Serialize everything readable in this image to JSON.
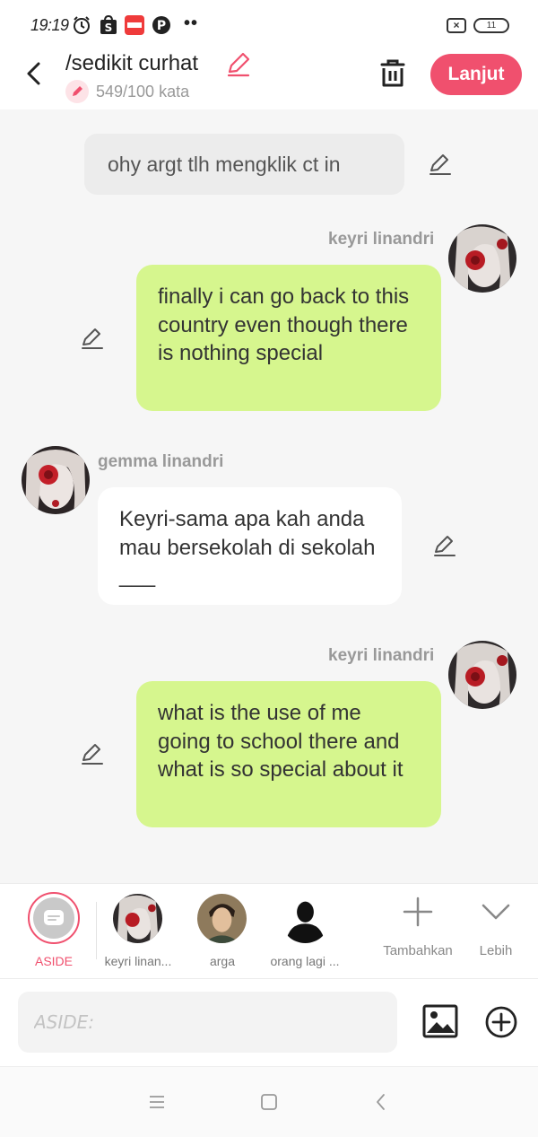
{
  "status_bar": {
    "time": "19:19",
    "icons": [
      "alarm-icon",
      "shopee-icon",
      "mangatoon-icon",
      "pinterest-icon",
      "more-dots-icon",
      "sim-x-icon",
      "battery-icon"
    ],
    "dots": "••",
    "battery_level": "11"
  },
  "header": {
    "title": "/sedikit curhat",
    "word_count": "549/100 kata",
    "next_label": "Lanjut",
    "accent_color": "#f0506e"
  },
  "messages": [
    {
      "type": "narration",
      "text": "ohy argt tlh mengklik ct in"
    },
    {
      "type": "right",
      "sender": "keyri linandri",
      "text": "finally i can go back to this country even though there is nothing special"
    },
    {
      "type": "left",
      "sender": "gemma linandri",
      "text": "Keyri-sama apa kah anda mau bersekolah di sekolah ___"
    },
    {
      "type": "right",
      "sender": "keyri linandri",
      "text": "what is the use of me going to school there and what is so special about it"
    }
  ],
  "characters": {
    "aside_label": "ASIDE",
    "list": [
      {
        "label": "keyri linan..."
      },
      {
        "label": "arga"
      },
      {
        "label": "orang lagi ..."
      }
    ],
    "add_label": "Tambahkan",
    "more_label": "Lebih"
  },
  "input": {
    "placeholder": "ASIDE:"
  },
  "colors": {
    "green_bubble": "#d6f68e",
    "chat_bg": "#f6f6f6"
  }
}
